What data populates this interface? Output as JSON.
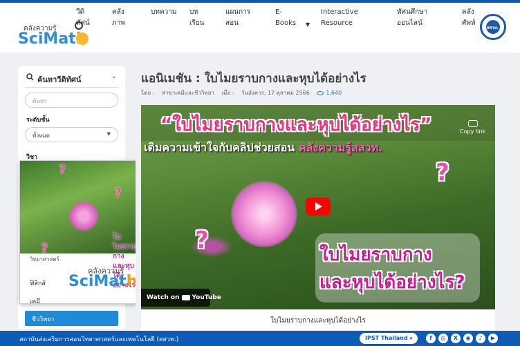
{
  "header": {
    "logo_small": "คลังความรู้",
    "logo_big_a": "SciMat",
    "logo_big_b": "h",
    "nav": [
      {
        "label": "วีดิ\nทัศน์"
      },
      {
        "label": "คลัง\nภาพ"
      },
      {
        "label": "บทความ"
      },
      {
        "label": "บท\nเรียน"
      },
      {
        "label": "แผนการ\nสอน"
      },
      {
        "label": "E-\nBooks"
      },
      {
        "label": "Interactive\nResource"
      },
      {
        "label": "ทัศนศึกษา\nออนไลน์"
      },
      {
        "label": "คลัง\nศัพท์"
      }
    ],
    "ipst_label": "สสวท."
  },
  "sidebar": {
    "title": "ค้นหาวีดิทัศน์",
    "search_placeholder": "ค้นหา",
    "level_label": "ระดับชั้น",
    "level_value": "ทั้งหมด",
    "subject_label": "วิชา",
    "subjects": [
      {
        "label": "วิทยาศาสตร์",
        "active": false
      },
      {
        "label": "ฟิสิกส์",
        "active": false
      },
      {
        "label": "เคมี",
        "active": false
      },
      {
        "label": "ชีววิทยา",
        "active": true
      }
    ]
  },
  "mini_player": {
    "overlay_text": "ใบไมยราบกาง\nและหุบได้อย่างไร?",
    "logo_small": "คลังความรู้",
    "logo_big_a": "SciMat",
    "logo_big_b": "h",
    "partial_item": "วิทยาศาสตร์"
  },
  "main": {
    "title": "แอนิเมชัน : ใบไมยราบกางและหุบได้อย่างไร",
    "meta_by_label": "โดย :",
    "meta_author": "สาขาเคมีและชีววิทยา",
    "meta_when_label": "เมื่อ :",
    "meta_date": "วันอังคาร, 17 ตุลาคม 2566",
    "meta_views": "1,640",
    "video": {
      "headline": "“ใบไมยราบกางและหุบได้อย่างไร”",
      "sub_a": "เติมความเข้าใจกับคลิปช่วยสอน ",
      "sub_b": "คลังความรู้สสวท.",
      "copy_link": "Copy link",
      "caption_1": "ใบไมยราบกาง",
      "caption_2": "และหุบได้อย่างไร?",
      "watch_on": "Watch on",
      "youtube": "YouTube"
    },
    "video_caption": "ใบไมยราบกางและหุบได้อย่างไร"
  },
  "footer": {
    "org": "สถาบันส่งเสริมการสอนวิทยาศาสตร์และเทคโนโลยี (สสวท.)",
    "badge": "IPST Thailand",
    "social": [
      "f",
      "◎",
      "X",
      "◉",
      "♪",
      "▶"
    ]
  }
}
